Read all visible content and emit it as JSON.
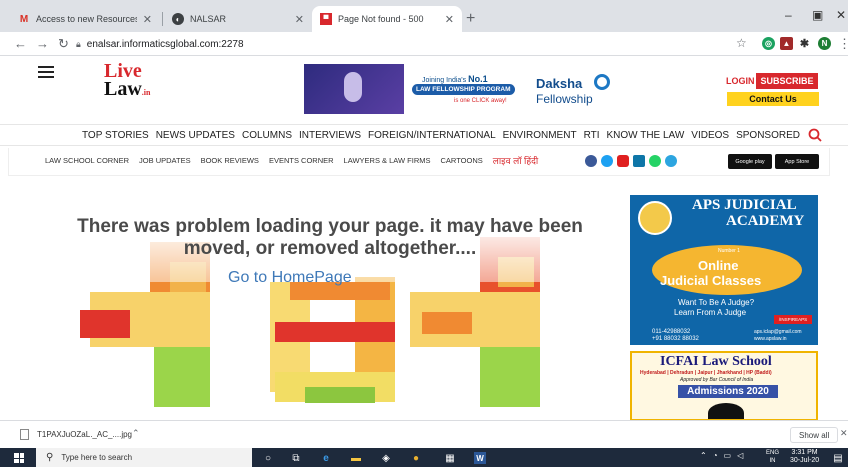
{
  "browser": {
    "tabs": [
      {
        "title": "Access to new Resources for the",
        "favicon": "gmail-icon",
        "active": false
      },
      {
        "title": "NALSAR",
        "favicon": "globe-icon",
        "active": false
      },
      {
        "title": "Page Not found - 500",
        "favicon": "error-page-icon",
        "active": true
      }
    ],
    "new_tab": "+",
    "url": "enalsar.informaticsglobal.com:2278",
    "extension_n": "N"
  },
  "site": {
    "logo_line1": "Live",
    "logo_line2": "Law",
    "logo_tld": ".in",
    "banner": {
      "joining": "Joining India's",
      "no1": "No.1",
      "program": "LAW FELLOWSHIP PROGRAM",
      "click": "is one CLICK away!",
      "daksha": "Daksha",
      "fellowship": "Fellowship"
    },
    "login": "LOGIN",
    "subscribe": "SUBSCRIBE",
    "contact": "Contact Us",
    "nav_primary": [
      "TOP STORIES",
      "NEWS UPDATES",
      "COLUMNS",
      "INTERVIEWS",
      "FOREIGN/INTERNATIONAL",
      "ENVIRONMENT",
      "RTI",
      "KNOW THE LAW",
      "VIDEOS",
      "SPONSORED"
    ],
    "nav_secondary": [
      "LAW SCHOOL CORNER",
      "JOB UPDATES",
      "BOOK REVIEWS",
      "EVENTS CORNER",
      "LAWYERS & LAW FIRMS",
      "CARTOONS"
    ],
    "nav_hindi": "लाइव लॉ हिंदी",
    "store_google": "Google play",
    "store_apple": "App Store",
    "social_colors": [
      "#3b5998",
      "#1da1f2",
      "#e02020",
      "#0e76a8",
      "#25d366",
      "#2ca5e0"
    ]
  },
  "error": {
    "message": "There was problem loading your page. it may have been moved, or removed altogether....",
    "link": "Go to HomePage"
  },
  "ads": {
    "aps_line1": "APS JUDICIAL",
    "aps_line2": "ACADEMY",
    "aps_number": "Number 1",
    "aps_online": "Online",
    "aps_classes": "Judicial Classes",
    "aps_want": "Want To Be A Judge?",
    "aps_learn": "Learn From A Judge",
    "aps_yt": "/INSPIREAPS",
    "aps_phone1": "011-42988032",
    "aps_phone2": "+91 88032 88032",
    "aps_mail": "aps.iclap@gmail.com",
    "aps_web": "www.apslaw.in",
    "icfai_title": "ICFAI Law School",
    "icfai_cities": "Hyderabad | Dehradun | Jaipur | Jharkhand | HP (Baddi)",
    "icfai_approved": "Approved by Bar Council of India",
    "icfai_admissions": "Admissions 2020"
  },
  "download": {
    "file": "T1PAXJuOZaL._AC_....jpg",
    "show_all": "Show all"
  },
  "taskbar": {
    "search_placeholder": "Type here to search",
    "lang": "ENG",
    "lang_sub": "IN",
    "time": "3:31 PM",
    "date": "30-Jul-20"
  }
}
